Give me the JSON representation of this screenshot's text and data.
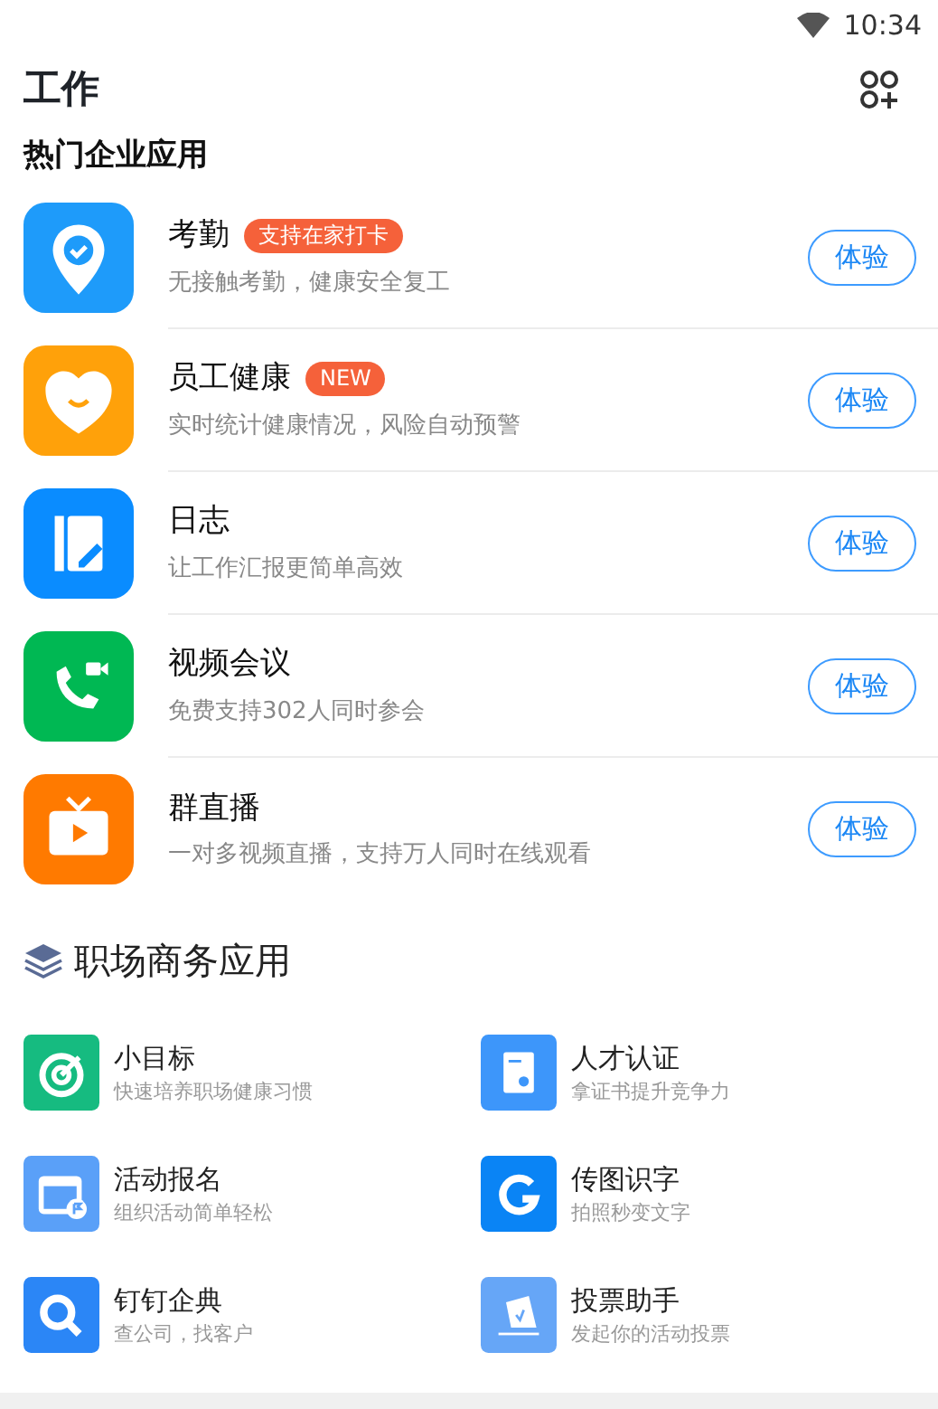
{
  "status_bar": {
    "time": "10:34"
  },
  "header": {
    "title": "工作"
  },
  "hot_section": {
    "title": "热门企业应用",
    "apps": [
      {
        "kind": "pin",
        "color": "#1e9bfa",
        "name": "考勤",
        "badge": "支持在家打卡",
        "description": "无接触考勤，健康安全复工",
        "button": "体验"
      },
      {
        "kind": "heart",
        "color": "#ffa10a",
        "name": "员工健康",
        "badge": "NEW",
        "description": "实时统计健康情况，风险自动预警",
        "button": "体验"
      },
      {
        "kind": "notebook",
        "color": "#0a8cff",
        "name": "日志",
        "description": "让工作汇报更简单高效",
        "button": "体验"
      },
      {
        "kind": "phone",
        "color": "#00b853",
        "name": "视频会议",
        "description": "免费支持302人同时参会",
        "button": "体验"
      },
      {
        "kind": "tv",
        "color": "#ff7a00",
        "name": "群直播",
        "description": "一对多视频直播，支持万人同时在线观看",
        "button": "体验"
      }
    ]
  },
  "business_section": {
    "title": "职场商务应用",
    "apps": [
      {
        "kind": "target",
        "color": "#16bb80",
        "name": "小目标",
        "description": "快速培养职场健康习惯"
      },
      {
        "kind": "certificate",
        "color": "#3d96fa",
        "name": "人才认证",
        "description": "拿证书提升竞争力"
      },
      {
        "kind": "calendar",
        "color": "#5aa0f8",
        "name": "活动报名",
        "description": "组织活动简单轻松"
      },
      {
        "kind": "swirl",
        "color": "#0a84f5",
        "name": "传图识字",
        "description": "拍照秒变文字"
      },
      {
        "kind": "magnifier",
        "color": "#2b86f6",
        "name": "钉钉企典",
        "description": "查公司，找客户"
      },
      {
        "kind": "ballot",
        "color": "#66a6f7",
        "name": "投票助手",
        "description": "发起你的活动投票"
      }
    ]
  }
}
